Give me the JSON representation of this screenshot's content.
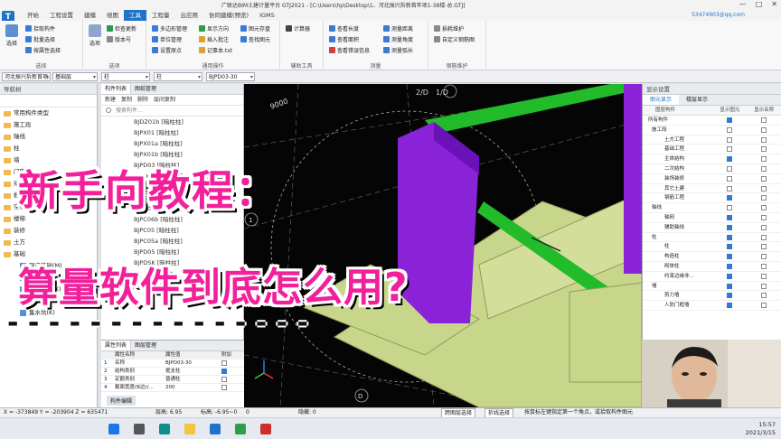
{
  "window": {
    "title": "广联达BIM土建计量平台 GTJ2021 - [C:\\Users\\hp\\Desktop\\1、河北振兴拆新首年项1-38楼-总.GTJ]",
    "controls": [
      "—",
      "□",
      "✕"
    ]
  },
  "ribbon": {
    "logo": "T",
    "tabs": [
      "开始",
      "工程设置",
      "建模",
      "视图",
      "工具",
      "工程量",
      "云应用",
      "协同建模(预览)",
      "IGMS"
    ],
    "active_tab": "工具",
    "user": "53474903@qq.com",
    "groups": [
      {
        "label": "选择",
        "buttons": [
          "选择",
          "拾取构件",
          "批量选择",
          "按属性选择"
        ]
      },
      {
        "label": "选项",
        "buttons": [
          "选项",
          "检查更新",
          "版本号"
        ]
      },
      {
        "label": "通用操作",
        "buttons": [
          "多边形管理",
          "单位管理",
          "设置原点",
          "显示方向",
          "插入批注",
          "记事本.txt",
          "图元存盘",
          "查找图元"
        ]
      },
      {
        "label": "辅助工具",
        "buttons": [
          "计算器"
        ]
      },
      {
        "label": "测量",
        "buttons": [
          "查看长度",
          "测量距离",
          "查看面积",
          "测量角度",
          "查看错误信息",
          "测量弧长"
        ]
      },
      {
        "label": "钢筋维护",
        "buttons": [
          "损耗维护",
          "自定义钢筋图"
        ]
      }
    ]
  },
  "toolbar2": {
    "floor": "河北振兴拆新首项...",
    "layer": "基础层",
    "category": "柱",
    "type": "柱",
    "component": "BJPD03-30"
  },
  "nav": {
    "title": "导航树",
    "items": [
      "常用构件类型",
      "施工段",
      "轴线",
      "柱",
      "墙",
      "门窗洞",
      "梁",
      "板",
      "空心楼盖",
      "楼梯",
      "装修",
      "土方",
      "基础"
    ],
    "sub_items": [
      "现浇基础(M)",
      "筏板主筋(R)",
      "筏板负筋(X)",
      "基础板带(W)",
      "集水坑(K)"
    ]
  },
  "components": {
    "tabs": [
      "构件列表",
      "图纸管理"
    ],
    "toolbar": [
      "新建",
      "复制",
      "删除",
      "层间复制"
    ],
    "search_placeholder": "搜索构件...",
    "items": [
      "BJDZ01b [暗柱柱]",
      "BJPX01 [暗柱柱]",
      "BJPX01a [暗柱柱]",
      "BJPX01b [暗柱柱]",
      "BJPD03 [暗柱柱]",
      "BJPD03a [暗柱柱]",
      "BJPBD03b [暗柱柱]",
      "BJPC06 [暗柱柱]",
      "BJPC06a [暗柱柱]",
      "BJPC06b [暗柱柱]",
      "BJPC05 [暗柱柱]",
      "BJPC05a [暗柱柱]",
      "BJPD05 [暗柱柱]",
      "BJPDSK [暗柱柱]"
    ]
  },
  "properties": {
    "tabs": [
      "属性列表",
      "图层管理"
    ],
    "header": [
      "",
      "属性名称",
      "属性值",
      "附加"
    ],
    "rows": [
      {
        "n": "1",
        "name": "名称",
        "value": "BJPD03-30",
        "add": false
      },
      {
        "n": "2",
        "name": "结构类别",
        "value": "框支柱",
        "add": true
      },
      {
        "n": "3",
        "name": "定额类别",
        "value": "普通柱",
        "add": false
      },
      {
        "n": "4",
        "name": "截面宽度(B边)(...",
        "value": "200",
        "add": false
      }
    ],
    "footer": "构件编辑"
  },
  "viewport": {
    "labels": {
      "grid_2d": "2/D",
      "grid_1d": "1/D",
      "dim": "9000",
      "axis_1": "1",
      "axis_d": "D"
    }
  },
  "display": {
    "title": "显示设置",
    "tabs": [
      "图元显示",
      "楼层显示"
    ],
    "header": [
      "图层构件",
      "显示图元",
      "显示名称"
    ],
    "rows": [
      {
        "name": "所有构件",
        "level": 0,
        "show": true,
        "label": false
      },
      {
        "name": "施工段",
        "level": 1,
        "show": false,
        "label": false
      },
      {
        "name": "土方工程",
        "level": 2,
        "show": false,
        "label": false
      },
      {
        "name": "基础工程",
        "level": 2,
        "show": false,
        "label": false
      },
      {
        "name": "主体结构",
        "level": 2,
        "show": true,
        "label": false
      },
      {
        "name": "二次结构",
        "level": 2,
        "show": false,
        "label": false
      },
      {
        "name": "装饰装修",
        "level": 2,
        "show": false,
        "label": false
      },
      {
        "name": "其它土建",
        "level": 2,
        "show": false,
        "label": false
      },
      {
        "name": "钢筋工程",
        "level": 2,
        "show": true,
        "label": false
      },
      {
        "name": "轴线",
        "level": 1,
        "show": false,
        "label": false
      },
      {
        "name": "轴网",
        "level": 2,
        "show": true,
        "label": false
      },
      {
        "name": "辅助轴线",
        "level": 2,
        "show": true,
        "label": false
      },
      {
        "name": "柱",
        "level": 1,
        "show": true,
        "label": false
      },
      {
        "name": "柱",
        "level": 2,
        "show": true,
        "label": false
      },
      {
        "name": "构造柱",
        "level": 2,
        "show": true,
        "label": false
      },
      {
        "name": "砌体柱",
        "level": 2,
        "show": true,
        "label": false
      },
      {
        "name": "约束边缘非...",
        "level": 2,
        "show": true,
        "label": false
      },
      {
        "name": "墙",
        "level": 1,
        "show": true,
        "label": false
      },
      {
        "name": "剪力墙",
        "level": 2,
        "show": true,
        "label": false
      },
      {
        "name": "人防门框墙",
        "level": 2,
        "show": true,
        "label": false
      }
    ]
  },
  "status": {
    "coords": "X = -373849 Y = -203904 Z = 635471",
    "floor_height": "层高: 6.95",
    "elevation": "标高: -6.95~0",
    "count": "0",
    "hidden": "隐藏: 0",
    "btn_snap": "跨图层选择",
    "btn_trace": "折线选择",
    "hint": "按鼠标左键指定第一个角点，或拾取构件图元"
  },
  "taskbar": {
    "time": "15:57",
    "date": "2021/3/15"
  },
  "overlay": {
    "title_line1": "新手向教程：",
    "title_line2": "算量软件到底怎么用?",
    "underline": "- - - - - - - - - - - - - - -"
  }
}
